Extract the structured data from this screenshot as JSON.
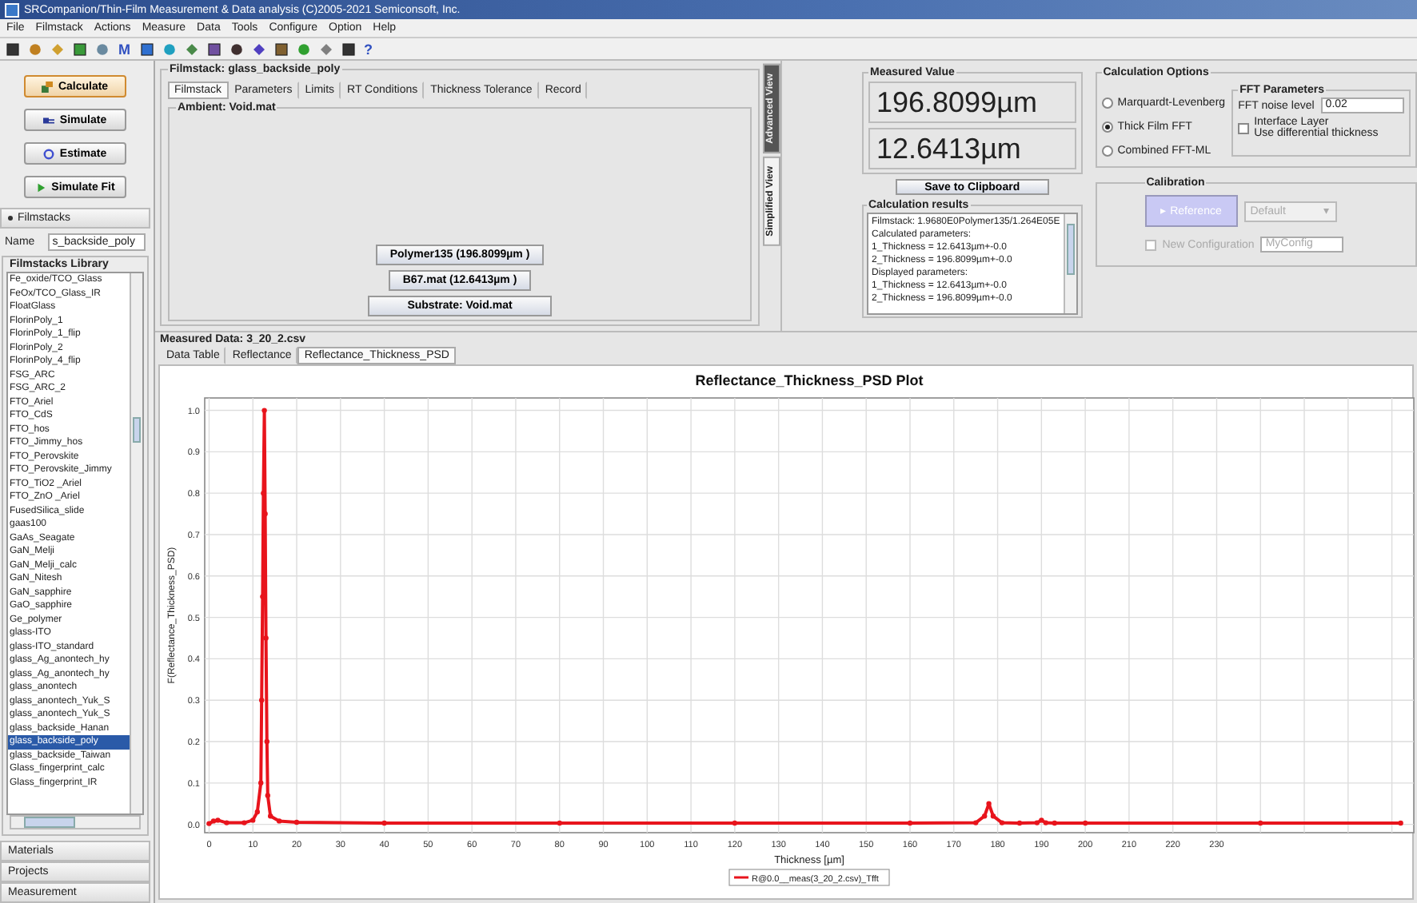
{
  "window": {
    "title": "SRCompanion/Thin-Film Measurement & Data analysis (C)2005-2021 Semiconsoft, Inc."
  },
  "menu": [
    "File",
    "Filmstack",
    "Actions",
    "Measure",
    "Data",
    "Tools",
    "Configure",
    "Option",
    "Help"
  ],
  "toolbar": [
    {
      "kind": "icon"
    },
    {
      "kind": "icon"
    },
    {
      "kind": "icon"
    },
    {
      "kind": "icon"
    },
    {
      "kind": "icon"
    },
    {
      "kind": "glyph",
      "text": "M"
    },
    {
      "kind": "icon"
    },
    {
      "kind": "icon"
    },
    {
      "kind": "icon"
    },
    {
      "kind": "icon"
    },
    {
      "kind": "icon"
    },
    {
      "kind": "icon"
    },
    {
      "kind": "icon"
    },
    {
      "kind": "icon"
    },
    {
      "kind": "icon"
    },
    {
      "kind": "icon"
    },
    {
      "kind": "glyph",
      "text": "?"
    }
  ],
  "actions": [
    {
      "label": "Calculate",
      "kind": "calculate",
      "selected": true
    },
    {
      "label": "Simulate",
      "kind": "simulate",
      "selected": false
    },
    {
      "label": "Estimate",
      "kind": "estimate",
      "selected": false
    },
    {
      "label": "Simulate Fit",
      "kind": "fit",
      "selected": false
    }
  ],
  "filmstacks": {
    "header": "Filmstacks",
    "name_label": "Name",
    "name_value": "s_backside_poly",
    "library_title": "Filmstacks Library",
    "items": [
      {
        "label": "Fe_oxide/TCO_Glass",
        "selected": false
      },
      {
        "label": "FeOx/TCO_Glass_IR",
        "selected": false
      },
      {
        "label": "FloatGlass",
        "selected": false
      },
      {
        "label": "FlorinPoly_1",
        "selected": false
      },
      {
        "label": "FlorinPoly_1_flip",
        "selected": false
      },
      {
        "label": "FlorinPoly_2",
        "selected": false
      },
      {
        "label": "FlorinPoly_4_flip",
        "selected": false
      },
      {
        "label": "FSG_ARC",
        "selected": false
      },
      {
        "label": "FSG_ARC_2",
        "selected": false
      },
      {
        "label": "FTO_Ariel",
        "selected": false
      },
      {
        "label": "FTO_CdS",
        "selected": false
      },
      {
        "label": "FTO_hos",
        "selected": false
      },
      {
        "label": "FTO_Jimmy_hos",
        "selected": false
      },
      {
        "label": "FTO_Perovskite",
        "selected": false
      },
      {
        "label": "FTO_Perovskite_Jimmy",
        "selected": false
      },
      {
        "label": "FTO_TiO2 _Ariel",
        "selected": false
      },
      {
        "label": "FTO_ZnO _Ariel",
        "selected": false
      },
      {
        "label": "FusedSilica_slide",
        "selected": false
      },
      {
        "label": "gaas100",
        "selected": false
      },
      {
        "label": "GaAs_Seagate",
        "selected": false
      },
      {
        "label": "GaN_Melji",
        "selected": false
      },
      {
        "label": "GaN_Melji_calc",
        "selected": false
      },
      {
        "label": "GaN_Nitesh",
        "selected": false
      },
      {
        "label": "GaN_sapphire",
        "selected": false
      },
      {
        "label": "GaO_sapphire",
        "selected": false
      },
      {
        "label": "Ge_polymer",
        "selected": false
      },
      {
        "label": "glass-ITO",
        "selected": false
      },
      {
        "label": "glass-ITO_standard",
        "selected": false
      },
      {
        "label": "glass_Ag_anontech_hy",
        "selected": false
      },
      {
        "label": "glass_Ag_anontech_hy",
        "selected": false
      },
      {
        "label": "glass_anontech",
        "selected": false
      },
      {
        "label": "glass_anontech_Yuk_S",
        "selected": false
      },
      {
        "label": "glass_anontech_Yuk_S",
        "selected": false
      },
      {
        "label": "glass_backside_Hanan",
        "selected": false
      },
      {
        "label": "glass_backside_poly",
        "selected": true
      },
      {
        "label": "glass_backside_Taiwan",
        "selected": false
      },
      {
        "label": "Glass_fingerprint_calc",
        "selected": false
      },
      {
        "label": "Glass_fingerprint_IR",
        "selected": false
      }
    ]
  },
  "panels": [
    "Materials",
    "Projects",
    "Measurement"
  ],
  "filmstack_editor": {
    "title": "Filmstack: glass_backside_poly",
    "tabs": [
      {
        "label": "Filmstack",
        "selected": true
      },
      {
        "label": "Parameters",
        "selected": false
      },
      {
        "label": "Limits",
        "selected": false
      },
      {
        "label": "RT Conditions",
        "selected": false
      },
      {
        "label": "Thickness Tolerance",
        "selected": false
      },
      {
        "label": "Record",
        "selected": false
      }
    ],
    "ambient": "Ambient: Void.mat",
    "layers": [
      "Polymer135 (196.8099µm )",
      "B67.mat (12.6413µm )",
      "Substrate: Void.mat"
    ]
  },
  "view_tabs": [
    {
      "label": "Advanced View",
      "selected": true
    },
    {
      "label": "Simplified View",
      "selected": false
    }
  ],
  "measured_value": {
    "title": "Measured Value",
    "values": [
      "196.8099µm",
      "12.6413µm"
    ]
  },
  "save_button": "Save to Clipboard",
  "calculation_results": {
    "title": "Calculation results",
    "lines": [
      "Filmstack: 1.9680E0Polymer135/1.264E05E",
      "Calculated parameters:",
      "1_Thickness = 12.6413µm+-0.0",
      "2_Thickness = 196.8099µm+-0.0",
      "Displayed parameters:",
      "1_Thickness = 12.6413µm+-0.0",
      "2_Thickness = 196.8099µm+-0.0"
    ]
  },
  "calculation_options": {
    "title": "Calculation Options",
    "methods": [
      {
        "label": "Marquardt-Levenberg",
        "selected": false
      },
      {
        "label": "Thick Film FFT",
        "selected": true
      },
      {
        "label": "Combined FFT-ML",
        "selected": false
      }
    ],
    "fft": {
      "title": "FFT Parameters",
      "noise_label": "FFT noise level",
      "noise_value": "0.02",
      "interface_layer": {
        "lines": [
          "Interface Layer",
          "Use differential thickness"
        ],
        "checked": false
      }
    }
  },
  "calibration": {
    "title": "Calibration",
    "reference_button": {
      "icon": "▸",
      "label": "Reference",
      "disabled": true
    },
    "config_select": {
      "value": "Default",
      "caret": "▾",
      "disabled": true
    },
    "new_configuration": {
      "label": "New Configuration",
      "checked": false,
      "disabled": true
    },
    "config_name": {
      "value": "MyConfig"
    }
  },
  "measured_data": {
    "title": "Measured Data: 3_20_2.csv",
    "tabs": [
      {
        "label": "Data Table",
        "selected": false
      },
      {
        "label": "Reflectance",
        "selected": false
      },
      {
        "label": "Reflectance_Thickness_PSD",
        "selected": true
      }
    ],
    "chart_data": {
      "type": "line",
      "title": "Reflectance_Thickness_PSD Plot",
      "xlabel": "Thickness [µm]",
      "ylabel": "F(Reflectance_Thickness_PSD)",
      "x": [
        0,
        1,
        2,
        4,
        8,
        10,
        11,
        11.8,
        12.0,
        12.2,
        12.4,
        12.6,
        12.8,
        13.0,
        13.2,
        13.4,
        14,
        16,
        20,
        40,
        80,
        120,
        160,
        175,
        177,
        178,
        179,
        181,
        185,
        189,
        190,
        191,
        193,
        200,
        240,
        272
      ],
      "series": [
        {
          "name": "R@0.0__meas(3_20_2.csv)_Tfft",
          "color": "#e8141c",
          "values": [
            0.002,
            0.008,
            0.01,
            0.004,
            0.004,
            0.01,
            0.03,
            0.1,
            0.3,
            0.55,
            0.8,
            1.0,
            0.75,
            0.45,
            0.2,
            0.07,
            0.02,
            0.008,
            0.005,
            0.003,
            0.003,
            0.003,
            0.003,
            0.004,
            0.02,
            0.05,
            0.02,
            0.004,
            0.003,
            0.004,
            0.01,
            0.004,
            0.003,
            0.003,
            0.003,
            0.003
          ]
        }
      ],
      "xlim": [
        -1,
        275
      ],
      "ylim": [
        -0.02,
        1.03
      ],
      "xticks": [
        0,
        10,
        20,
        30,
        40,
        50,
        60,
        70,
        80,
        90,
        100,
        110,
        120,
        130,
        140,
        150,
        160,
        170,
        180,
        190,
        200,
        210,
        220,
        230
      ],
      "yticks": [
        {
          "value": 0,
          "label": "0.0"
        },
        {
          "value": 0.1,
          "label": "0.1"
        },
        {
          "value": 0.2,
          "label": "0.2"
        },
        {
          "value": 0.3,
          "label": "0.3"
        },
        {
          "value": 0.4,
          "label": "0.4"
        },
        {
          "value": 0.5,
          "label": "0.5"
        },
        {
          "value": 0.6,
          "label": "0.6"
        },
        {
          "value": 0.7,
          "label": "0.7"
        },
        {
          "value": 0.8,
          "label": "0.8"
        },
        {
          "value": 0.9,
          "label": "0.9"
        },
        {
          "value": 1,
          "label": "1.0"
        }
      ],
      "grid": true
    }
  }
}
